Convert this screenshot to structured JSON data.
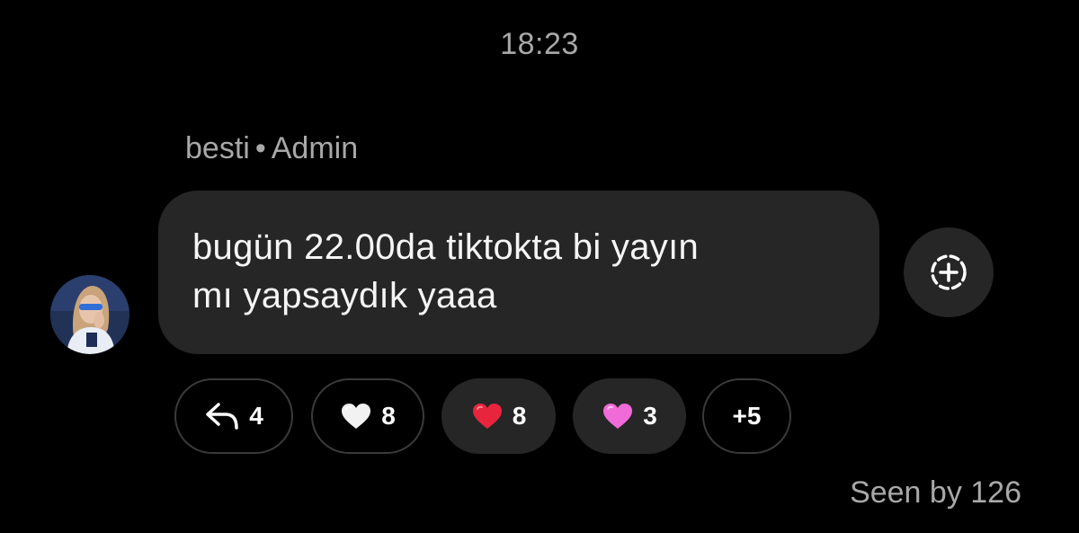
{
  "header": {
    "timestamp": "18:23"
  },
  "message": {
    "sender_name": "besti",
    "separator": "•",
    "sender_role": "Admin",
    "text_line_1": "bugün 22.00da tiktokta bi yayın",
    "text_line_2": "mı yapsaydık yaaa",
    "avatar_icon": "user-avatar-photo",
    "add_reaction_icon": "add-reaction-icon"
  },
  "reactions": [
    {
      "icon": "reply-icon",
      "count": "4",
      "style": "outline"
    },
    {
      "icon": "white-heart-emoji",
      "count": "8",
      "style": "outline",
      "color": "#f2f2f2"
    },
    {
      "icon": "red-heart-emoji",
      "count": "8",
      "style": "filled",
      "color": "#e8253d"
    },
    {
      "icon": "pink-heart-emoji",
      "count": "3",
      "style": "filled",
      "color": "#f06ad8"
    },
    {
      "icon": "more-reactions",
      "count": "+5",
      "style": "outline"
    }
  ],
  "footer": {
    "seen_text": "Seen by 126"
  },
  "colors": {
    "background": "#000000",
    "bubble": "#262626",
    "muted_text": "#a8a8a8"
  }
}
